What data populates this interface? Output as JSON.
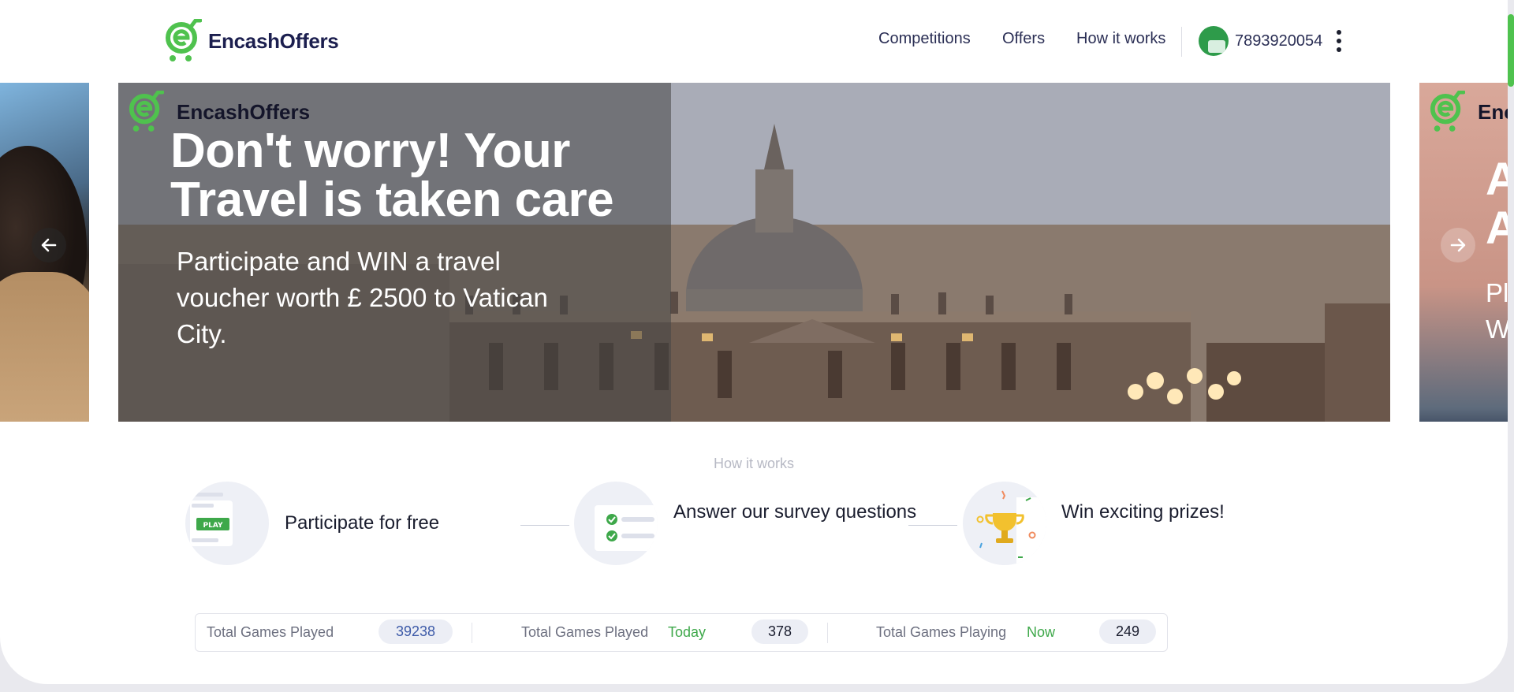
{
  "header": {
    "brand": "EncashOffers",
    "nav": [
      {
        "label": "Competitions"
      },
      {
        "label": "Offers"
      },
      {
        "label": "How it works"
      }
    ],
    "phone": "7893920054"
  },
  "carousel": {
    "active_slide": {
      "brand": "EncashOffers",
      "headline": "Don't worry! Your Travel is taken care",
      "subline": "Participate and WIN a travel voucher worth £ 2500 to Vatican City."
    },
    "next_slide": {
      "brand": "EncashOffers",
      "headline_partial": "A A",
      "subline_partial": "Pl W"
    }
  },
  "how_it_works": {
    "title": "How it works",
    "steps": [
      {
        "label": "Participate for free",
        "badge": "PLAY"
      },
      {
        "label": "Answer our survey questions"
      },
      {
        "label": "Win exciting prizes!"
      }
    ]
  },
  "stats": {
    "total_played": {
      "label": "Total Games Played",
      "value": "39238"
    },
    "played_today": {
      "label": "Total Games Played",
      "tag": "Today",
      "value": "378"
    },
    "playing_now": {
      "label": "Total Games Playing",
      "tag": "Now",
      "value": "249"
    }
  },
  "colors": {
    "brand_green": "#4fc24e",
    "brand_navy": "#1c1f4f",
    "stat_tag": "#3ea84a",
    "stat_value_blue": "#3d5aa8"
  }
}
